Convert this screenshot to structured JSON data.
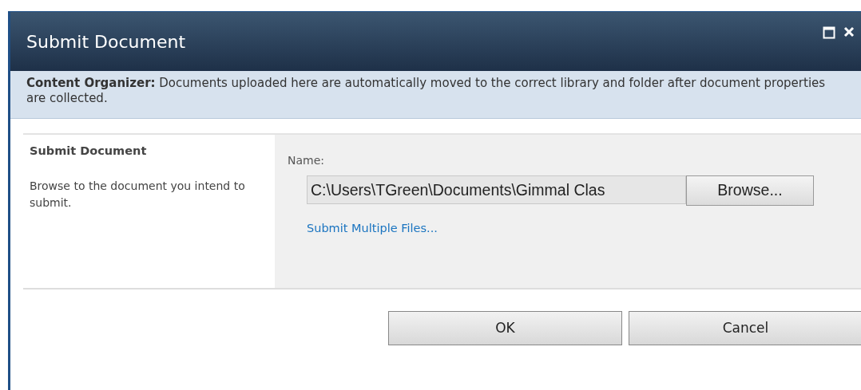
{
  "window": {
    "title": "Submit Document",
    "controls": [
      {
        "kind": "maximize"
      },
      {
        "kind": "close"
      }
    ]
  },
  "notice": "**Content Organizer:** Documents uploaded here are automatically moved to the correct library and folder after document properties are collected.",
  "section": {
    "title": "Submit Document",
    "description": "Browse to the document you intend to submit."
  },
  "form": {
    "label": "Name:",
    "file_value": "C:\\Users\\TGreen\\Documents\\Gimmal Clas",
    "browse": "Browse...",
    "link": "Submit Multiple Files..."
  },
  "buttons": [
    "OK",
    "Cancel"
  ]
}
